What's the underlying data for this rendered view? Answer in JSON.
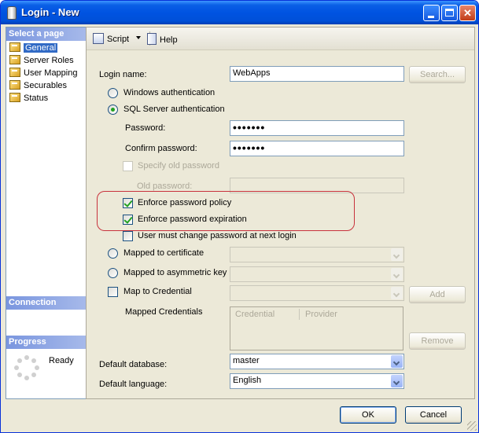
{
  "window": {
    "title": "Login - New"
  },
  "sidebar": {
    "select_page_header": "Select a page",
    "pages": [
      {
        "label": "General",
        "selected": true
      },
      {
        "label": "Server Roles"
      },
      {
        "label": "User Mapping"
      },
      {
        "label": "Securables"
      },
      {
        "label": "Status"
      }
    ],
    "connection_header": "Connection",
    "progress_header": "Progress",
    "progress_status": "Ready"
  },
  "toolbar": {
    "script_label": "Script",
    "help_label": "Help"
  },
  "form": {
    "login_name_label": "Login name:",
    "login_name_value": "WebApps",
    "search_button": "Search...",
    "windows_auth_label": "Windows authentication",
    "sql_auth_label": "SQL Server authentication",
    "password_label": "Password:",
    "password_value": "•••••••",
    "confirm_password_label": "Confirm password:",
    "confirm_password_value": "•••••••",
    "specify_old_password_label": "Specify old password",
    "old_password_label": "Old password:",
    "enforce_policy_label": "Enforce password policy",
    "enforce_expiration_label": "Enforce password expiration",
    "must_change_label": "User must change password at next login",
    "mapped_cert_label": "Mapped to certificate",
    "mapped_asym_label": "Mapped to asymmetric key",
    "map_credential_label": "Map to Credential",
    "add_button": "Add",
    "mapped_credentials_label": "Mapped Credentials",
    "credentials_columns": [
      "Credential",
      "Provider"
    ],
    "remove_button": "Remove",
    "default_database_label": "Default database:",
    "default_database_value": "master",
    "default_language_label": "Default language:",
    "default_language_value": "English"
  },
  "footer": {
    "ok_button": "OK",
    "cancel_button": "Cancel"
  },
  "colors": {
    "title_bar": "#0053e1",
    "highlight_outline": "#c8323c",
    "sidebar_header": "#7a96df",
    "selection": "#316ac5"
  }
}
